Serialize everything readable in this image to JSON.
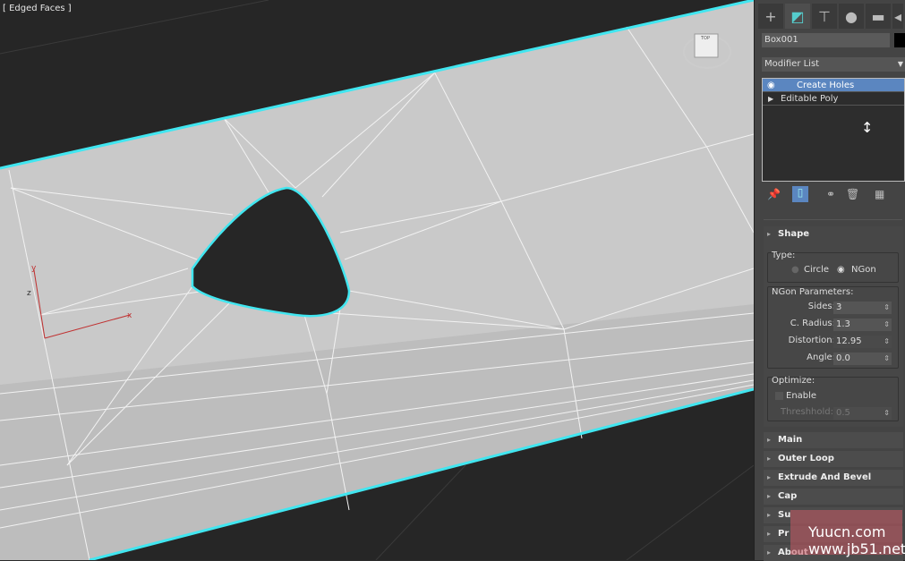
{
  "viewport": {
    "label": "[ Edged Faces ]",
    "viewcube": "TOP",
    "axis": {
      "x": "x",
      "y": "y",
      "z": "z"
    }
  },
  "panel": {
    "tabs": [
      {
        "icon": "plus-icon",
        "glyph": "+"
      },
      {
        "icon": "modify-icon",
        "glyph": "◩"
      },
      {
        "icon": "hierarchy-icon",
        "glyph": "⊤"
      },
      {
        "icon": "motion-icon",
        "glyph": "●"
      },
      {
        "icon": "display-icon",
        "glyph": "▬"
      },
      {
        "icon": "arrow-left-icon",
        "glyph": "◂"
      }
    ],
    "object_name": "Box001",
    "object_color": "#000000",
    "modifier_list": "Modifier List",
    "stack": [
      {
        "label": "Create Holes",
        "selected": true
      },
      {
        "label": "Editable Poly",
        "selected": false
      }
    ],
    "shape": {
      "title": "Shape",
      "type_label": "Type:",
      "circle": "Circle",
      "ngon": "NGon",
      "selected": "NGon",
      "ngon_params": "NGon Parameters:",
      "params": [
        {
          "label": "Sides:",
          "value": "3"
        },
        {
          "label": "C. Radius:",
          "value": "1.3"
        },
        {
          "label": "Distortion:",
          "value": "12.95"
        },
        {
          "label": "Angle:",
          "value": "0.0"
        }
      ],
      "optimize": "Optimize:",
      "enable": "Enable",
      "threshold_label": "Threshhold:",
      "threshold": "0.5"
    },
    "rollouts": [
      "Main",
      "Outer Loop",
      "Extrude And Bevel",
      "Cap",
      "Su",
      "Pr",
      "About"
    ],
    "watermark": "Yuucn.com www.jb51.net",
    "accent": "#5b86c0",
    "selection": "#41e6f0"
  }
}
